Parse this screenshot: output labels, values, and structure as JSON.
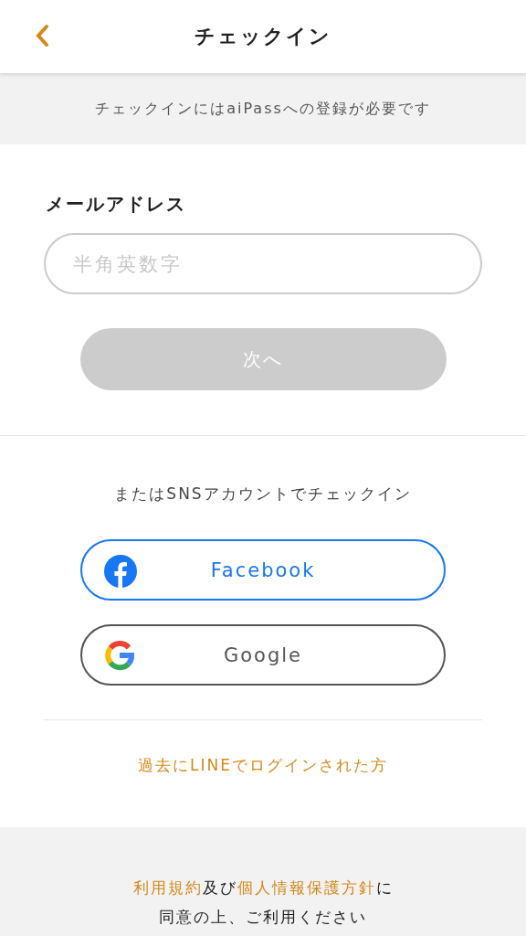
{
  "header": {
    "title": "チェックイン"
  },
  "notice": "チェックインにはaiPassへの登録が必要です",
  "email": {
    "label": "メールアドレス",
    "placeholder": "半角英数字"
  },
  "next_button": {
    "label": "次へ",
    "disabled": true
  },
  "sns": {
    "caption": "またはSNSアカウントでチェックイン",
    "buttons": [
      {
        "kind": "facebook",
        "label": "Facebook"
      },
      {
        "kind": "google",
        "label": "Google"
      }
    ]
  },
  "line_link": "過去にLINEでログインされた方",
  "footer": {
    "terms_link": "利用規約",
    "connector": "及び",
    "privacy_link": "個人情報保護方針",
    "suffix": "に",
    "line_2": "同意の上、ご利用ください"
  }
}
